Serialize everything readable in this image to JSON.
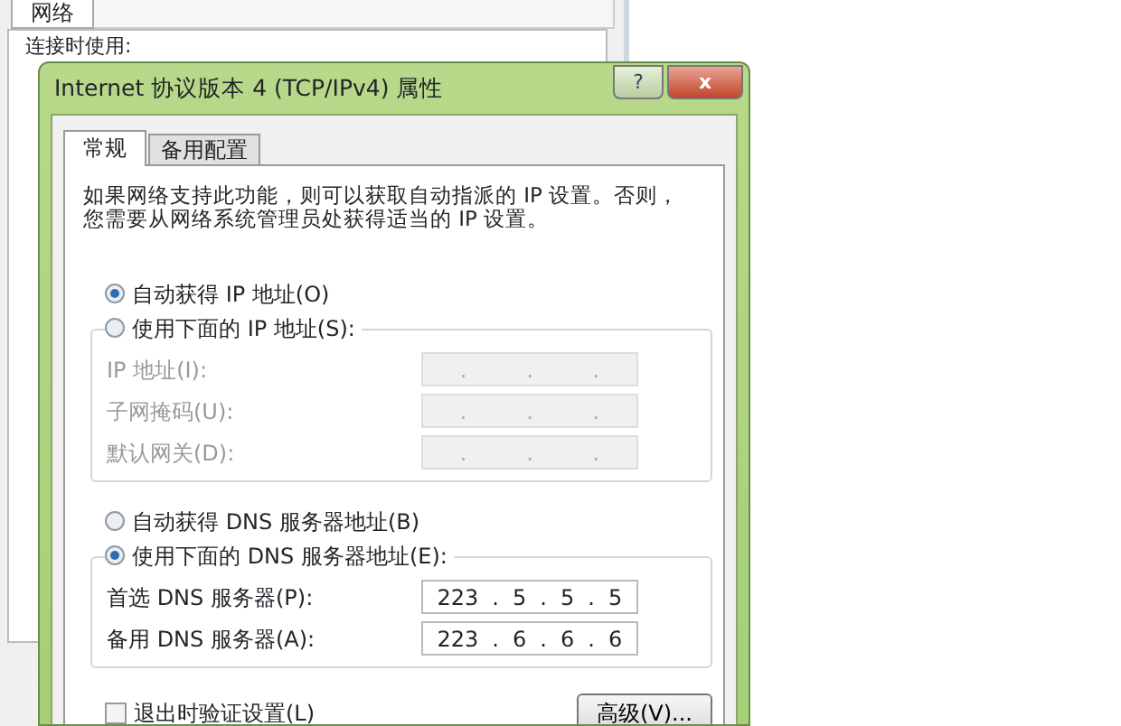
{
  "background_window": {
    "tab": "网络",
    "label": "连接时使用:"
  },
  "dialog": {
    "title": "Internet 协议版本 4 (TCP/IPv4) 属性",
    "help": "?",
    "close": "x",
    "tabs": [
      {
        "label": "常规",
        "selected": true
      },
      {
        "label": "备用配置",
        "selected": false
      }
    ],
    "description": [
      "如果网络支持此功能，则可以获取自动指派的 IP 设置。否则，",
      "您需要从网络系统管理员处获得适当的 IP 设置。"
    ],
    "sections": [
      {
        "auto_option": {
          "label": "自动获得 IP 地址(O)",
          "selected": true
        },
        "manual_option": {
          "label": "使用下面的 IP 地址(S):",
          "selected": false
        },
        "fields": [
          {
            "label": "IP 地址(I):",
            "disabled": true,
            "separator": "."
          },
          {
            "label": "子网掩码(U):",
            "disabled": true,
            "separator": "."
          },
          {
            "label": "默认网关(D):",
            "disabled": true,
            "separator": "."
          }
        ]
      },
      {
        "auto_option": {
          "label": "自动获得 DNS 服务器地址(B)",
          "selected": false
        },
        "manual_option": {
          "label": "使用下面的 DNS 服务器地址(E):",
          "selected": true
        },
        "fields": [
          {
            "label": "首选 DNS 服务器(P):",
            "disabled": false,
            "separator": ".",
            "octets": [
              "223",
              "5",
              "5",
              "5"
            ]
          },
          {
            "label": "备用 DNS 服务器(A):",
            "disabled": false,
            "separator": ".",
            "octets": [
              "223",
              "6",
              "6",
              "6"
            ]
          }
        ]
      }
    ],
    "validate": {
      "label": "退出时验证设置(L)",
      "checked": false
    },
    "advanced_button": "高级(V)..."
  }
}
